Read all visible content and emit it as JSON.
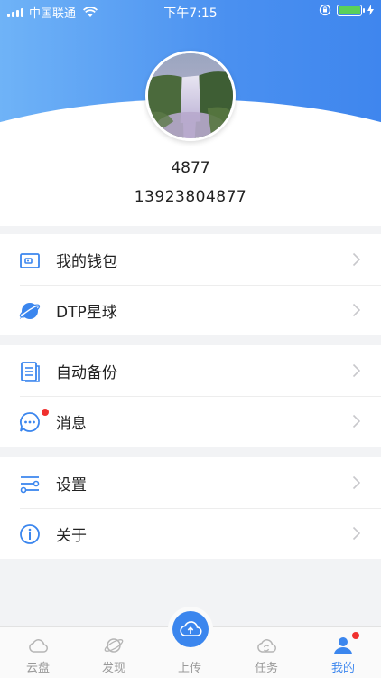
{
  "status_bar": {
    "carrier": "中国联通",
    "time": "下午7:15"
  },
  "profile": {
    "username": "4877",
    "phone": "13923804877"
  },
  "menu": {
    "wallet": "我的钱包",
    "planet": "DTP星球",
    "auto_backup": "自动备份",
    "messages": "消息",
    "settings": "设置",
    "about": "关于"
  },
  "tabbar": {
    "cloud": "云盘",
    "discover": "发现",
    "upload": "上传",
    "tasks": "任务",
    "mine": "我的"
  },
  "colors": {
    "accent": "#3b86ee",
    "badge": "#f0302e"
  }
}
